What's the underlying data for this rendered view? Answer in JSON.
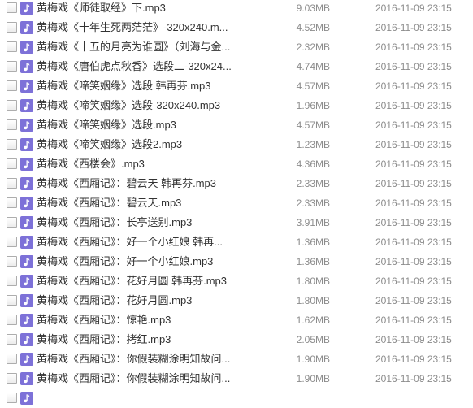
{
  "colors": {
    "icon_bg": "#7d71d8",
    "name_text": "#333333",
    "meta_text": "#8c8c8c",
    "checkbox_border": "#adadad"
  },
  "file_icon": "music-note-icon",
  "files": [
    {
      "name": "黄梅戏《师徒取经》下.mp3",
      "size": "9.03MB",
      "date": "2016-11-09 23:15",
      "checked": false
    },
    {
      "name": "黄梅戏《十年生死两茫茫》-320x240.m...",
      "size": "4.52MB",
      "date": "2016-11-09 23:15",
      "checked": false
    },
    {
      "name": "黄梅戏《十五的月亮为谁圆》（刘海与金...",
      "size": "2.32MB",
      "date": "2016-11-09 23:15",
      "checked": false
    },
    {
      "name": "黄梅戏《唐伯虎点秋香》选段二-320x24...",
      "size": "4.74MB",
      "date": "2016-11-09 23:15",
      "checked": false
    },
    {
      "name": "黄梅戏《啼笑姻缘》选段 韩再芬.mp3",
      "size": "4.57MB",
      "date": "2016-11-09 23:15",
      "checked": false
    },
    {
      "name": "黄梅戏《啼笑姻缘》选段-320x240.mp3",
      "size": "1.96MB",
      "date": "2016-11-09 23:15",
      "checked": false
    },
    {
      "name": "黄梅戏《啼笑姻缘》选段.mp3",
      "size": "4.57MB",
      "date": "2016-11-09 23:15",
      "checked": false
    },
    {
      "name": "黄梅戏《啼笑姻缘》选段2.mp3",
      "size": "1.23MB",
      "date": "2016-11-09 23:15",
      "checked": false
    },
    {
      "name": "黄梅戏《西楼会》.mp3",
      "size": "4.36MB",
      "date": "2016-11-09 23:15",
      "checked": false
    },
    {
      "name": "黄梅戏《西厢记》：碧云天 韩再芬.mp3",
      "size": "2.33MB",
      "date": "2016-11-09 23:15",
      "checked": false
    },
    {
      "name": "黄梅戏《西厢记》：碧云天.mp3",
      "size": "2.33MB",
      "date": "2016-11-09 23:15",
      "checked": false
    },
    {
      "name": "黄梅戏《西厢记》：长亭送别.mp3",
      "size": "3.91MB",
      "date": "2016-11-09 23:15",
      "checked": false
    },
    {
      "name": "黄梅戏《西厢记》：好一个小红娘 韩再...",
      "size": "1.36MB",
      "date": "2016-11-09 23:15",
      "checked": false
    },
    {
      "name": "黄梅戏《西厢记》：好一个小红娘.mp3",
      "size": "1.36MB",
      "date": "2016-11-09 23:15",
      "checked": false
    },
    {
      "name": "黄梅戏《西厢记》：花好月圆 韩再芬.mp3",
      "size": "1.80MB",
      "date": "2016-11-09 23:15",
      "checked": false
    },
    {
      "name": "黄梅戏《西厢记》：花好月圆.mp3",
      "size": "1.80MB",
      "date": "2016-11-09 23:15",
      "checked": false
    },
    {
      "name": "黄梅戏《西厢记》：惊艳.mp3",
      "size": "1.62MB",
      "date": "2016-11-09 23:15",
      "checked": false
    },
    {
      "name": "黄梅戏《西厢记》：拷红.mp3",
      "size": "2.05MB",
      "date": "2016-11-09 23:15",
      "checked": false
    },
    {
      "name": "黄梅戏《西厢记》：你假装糊涂明知故问...",
      "size": "1.90MB",
      "date": "2016-11-09 23:15",
      "checked": false
    },
    {
      "name": "黄梅戏《西厢记》：你假装糊涂明知故问...",
      "size": "1.90MB",
      "date": "2016-11-09 23:15",
      "checked": false
    }
  ]
}
